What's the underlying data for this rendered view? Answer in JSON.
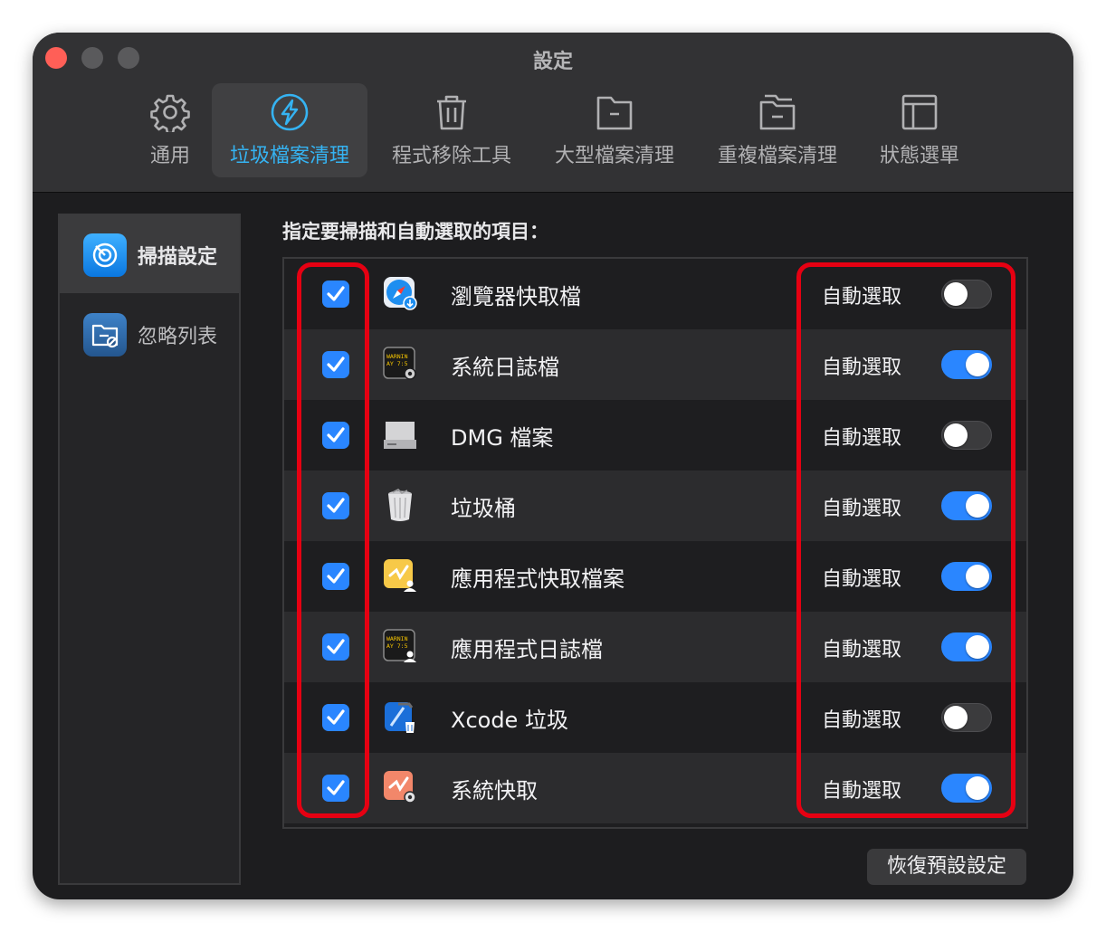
{
  "window": {
    "title": "設定"
  },
  "tabs": [
    {
      "label": "通用",
      "icon": "gear-icon"
    },
    {
      "label": "垃圾檔案清理",
      "icon": "lightning-icon",
      "active": true
    },
    {
      "label": "程式移除工具",
      "icon": "trash-icon"
    },
    {
      "label": "大型檔案清理",
      "icon": "folder-icon"
    },
    {
      "label": "重複檔案清理",
      "icon": "folders-icon"
    },
    {
      "label": "狀態選單",
      "icon": "layout-icon"
    }
  ],
  "sidebar": {
    "items": [
      {
        "label": "掃描設定",
        "icon": "radar-icon",
        "active": true
      },
      {
        "label": "忽略列表",
        "icon": "ignore-folder-icon",
        "active": false
      }
    ]
  },
  "main": {
    "heading": "指定要掃描和自動選取的項目：",
    "auto_label": "自動選取",
    "items": [
      {
        "label": "瀏覽器快取檔",
        "icon": "safari-download-icon",
        "checked": true,
        "auto_select": false
      },
      {
        "label": "系統日誌檔",
        "icon": "console-gear-icon",
        "checked": true,
        "auto_select": true
      },
      {
        "label": "DMG 檔案",
        "icon": "disk-image-icon",
        "checked": true,
        "auto_select": false
      },
      {
        "label": "垃圾桶",
        "icon": "trash-can-icon",
        "checked": true,
        "auto_select": true
      },
      {
        "label": "應用程式快取檔案",
        "icon": "app-cache-user-icon",
        "checked": true,
        "auto_select": true
      },
      {
        "label": "應用程式日誌檔",
        "icon": "console-user-icon",
        "checked": true,
        "auto_select": true
      },
      {
        "label": "Xcode 垃圾",
        "icon": "xcode-trash-icon",
        "checked": true,
        "auto_select": false
      },
      {
        "label": "系統快取",
        "icon": "system-cache-gear-icon",
        "checked": true,
        "auto_select": true
      }
    ],
    "console_icon_text": [
      "WARNIN",
      "AY 7:5"
    ],
    "reset_button": "恢復預設設定"
  },
  "colors": {
    "accent": "#2a86ff",
    "active_tab": "#35b3f2",
    "highlight": "#e60012"
  }
}
